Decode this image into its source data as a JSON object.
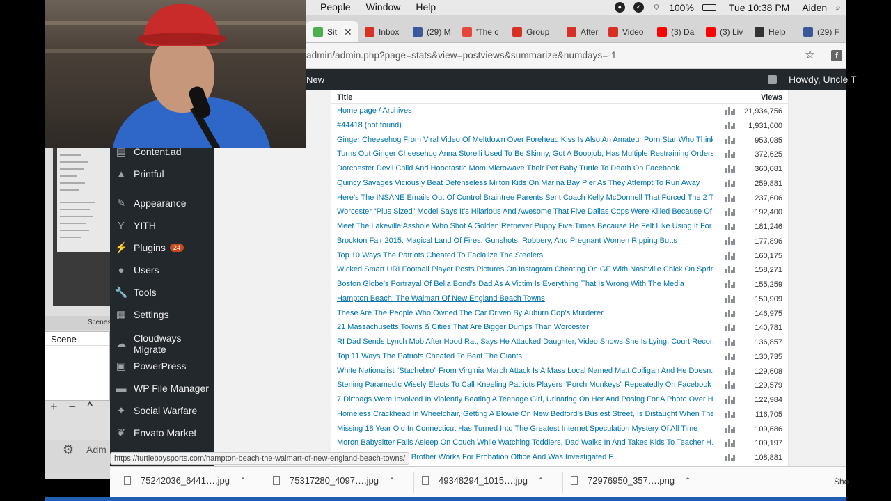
{
  "menubar": {
    "items": [
      "People",
      "Window",
      "Help"
    ],
    "battery": "100%",
    "clock": "Tue 10:38 PM",
    "user": "Aiden"
  },
  "tabs": [
    {
      "label": "Sit",
      "favicon_color": "#4caf50",
      "active": true
    },
    {
      "label": "Inbox",
      "favicon_color": "#d93025"
    },
    {
      "label": "(29) M",
      "favicon_color": "#3b5998"
    },
    {
      "label": "'The c",
      "favicon_color": "#e8453c"
    },
    {
      "label": "Group",
      "favicon_color": "#d93025"
    },
    {
      "label": "After",
      "favicon_color": "#d93025"
    },
    {
      "label": "Video",
      "favicon_color": "#d93025"
    },
    {
      "label": "(3) Da",
      "favicon_color": "#ff0000"
    },
    {
      "label": "(3) Liv",
      "favicon_color": "#ff0000"
    },
    {
      "label": "Help",
      "favicon_color": "#333333"
    },
    {
      "label": "(29) F",
      "favicon_color": "#3b5998"
    }
  ],
  "address": {
    "url": "admin/admin.php?page=stats&view=postviews&summarize&numdays=-1"
  },
  "adminbar": {
    "new_label": "New",
    "howdy": "Howdy, Uncle T"
  },
  "sidebar": {
    "items": [
      {
        "label": "Content.ad",
        "icon": "content-ad-icon",
        "glyph": "▤"
      },
      {
        "label": "Printful",
        "icon": "printful-icon",
        "glyph": "▲"
      },
      {
        "label": "Appearance",
        "icon": "paintbrush-icon",
        "glyph": "✎"
      },
      {
        "label": "YITH",
        "icon": "yith-icon",
        "glyph": "Y"
      },
      {
        "label": "Plugins",
        "icon": "plug-icon",
        "glyph": "⚡",
        "badge": "24"
      },
      {
        "label": "Users",
        "icon": "users-icon",
        "glyph": "●"
      },
      {
        "label": "Tools",
        "icon": "wrench-icon",
        "glyph": "🔧"
      },
      {
        "label": "Settings",
        "icon": "settings-icon",
        "glyph": "▦"
      },
      {
        "label": "Cloudways Migrate",
        "icon": "cloud-icon",
        "glyph": "☁"
      },
      {
        "label": "PowerPress",
        "icon": "podcast-icon",
        "glyph": "▣"
      },
      {
        "label": "WP File Manager",
        "icon": "folder-icon",
        "glyph": "▬"
      },
      {
        "label": "Social Warfare",
        "icon": "social-warfare-icon",
        "glyph": "✦"
      },
      {
        "label": "Envato Market",
        "icon": "leaf-icon",
        "glyph": "❦"
      }
    ]
  },
  "stats": {
    "col_title": "Title",
    "col_views": "Views",
    "rows": [
      {
        "title": "Home page / Archives",
        "views": "21,934,756"
      },
      {
        "title": "#44418 (not found)",
        "views": "1,931,600"
      },
      {
        "title": "Ginger Cheesehog From Viral Video Of Meltdown Over Forehead Kiss Is Also An Amateur Porn Star Who Think...",
        "views": "953,085"
      },
      {
        "title": "Turns Out Ginger Cheesehog Anna Storelli Used To Be Skinny, Got A Boobjob, Has Multiple Restraining Orders...",
        "views": "372,625"
      },
      {
        "title": "Dorchester Devil Child And Hoodtastic Mom Microwave Their Pet Baby Turtle To Death On Facebook",
        "views": "360,081"
      },
      {
        "title": "Quincy Savages Viciously Beat Defenseless Milton Kids On Marina Bay Pier As They Attempt To Run Away",
        "views": "259,881"
      },
      {
        "title": "Here’s The INSANE Emails Out Of Control Braintree Parents Sent Coach Kelly McDonnell That Forced The 2 Ti...",
        "views": "237,606"
      },
      {
        "title": "Worcester “Plus Sized” Model Says It’s Hilarious And Awesome That Five Dallas Cops Were Killed Because Of ...",
        "views": "192,400"
      },
      {
        "title": "Meet The Lakeville Asshole Who Shot A Golden Retriever Puppy Five Times Because He Felt Like Using It For ...",
        "views": "181,246"
      },
      {
        "title": "Brockton Fair 2015: Magical Land Of Fires, Gunshots, Robbery, And Pregnant Women Ripping Butts",
        "views": "177,896"
      },
      {
        "title": "Top 10 Ways The Patriots Cheated To Facialize The Steelers",
        "views": "160,175"
      },
      {
        "title": "Wicked Smart URI Football Player Posts Pictures On Instagram Cheating On GF With Nashville Chick On Sprin...",
        "views": "158,271"
      },
      {
        "title": "Boston Globe’s Portrayal Of Bella Bond’s Dad As A Victim Is Everything That Is Wrong With The Media",
        "views": "155,259"
      },
      {
        "title": "Hampton Beach: The Walmart Of New England Beach Towns",
        "views": "150,909",
        "hover": true
      },
      {
        "title": "These Are The People Who Owned The Car Driven By Auburn Cop’s Murderer",
        "views": "146,975"
      },
      {
        "title": "21 Massachusetts Towns & Cities That Are Bigger Dumps Than Worcester",
        "views": "140,781"
      },
      {
        "title": "RI Dad Sends Lynch Mob After Hood Rat, Says He Attacked Daughter, Video Shows She Is Lying, Court Recor...",
        "views": "136,857"
      },
      {
        "title": "Top 11 Ways The Patriots Cheated To Beat The Giants",
        "views": "130,735"
      },
      {
        "title": "White Nationalist “Stachebro” From Virginia March Attack Is A Mass Local Named Matt Colligan And He Doesn...",
        "views": "129,608"
      },
      {
        "title": "Sterling Paramedic Wisely Elects To Call Kneeling Patriots Players “Porch Monkeys” Repeatedly On Facebook",
        "views": "129,579"
      },
      {
        "title": "7 Dirtbags Were Involved In Violently Beating A Teenage Girl, Urinating On Her And Posing For A Photo Over H...",
        "views": "122,984"
      },
      {
        "title": "Homeless Crackhead In Wheelchair, Getting A Blowie On New Bedford’s Busiest Street, Is Distaught When The...",
        "views": "116,705"
      },
      {
        "title": "Missing 18 Year Old In Connecticut Has Turned Into The Greatest Internet Speculation Mystery Of All Time",
        "views": "109,686"
      },
      {
        "title": "Moron Babysitter Falls Asleep On Couch While Watching Toddlers, Dad Walks In And Takes Kids To Teacher H...",
        "views": "109,197"
      },
      {
        "title": "ng Jorge Zambrano’s Brother Works For Probation Office And Was Investigated F...",
        "views": "108,881"
      }
    ]
  },
  "obs": {
    "scenes_tab": "Scenes",
    "scene_header": "Scene",
    "controls": [
      "+",
      "−",
      "^"
    ],
    "admin_text": "Adm"
  },
  "status_url": "https://turtleboysports.com/hampton-beach-the-walmart-of-new-england-beach-towns/",
  "downloads": {
    "items": [
      "75242036_6441….jpg",
      "75317280_4097….jpg",
      "49348294_1015….jpg",
      "72976950_357….png"
    ],
    "show_all": "Sho"
  }
}
